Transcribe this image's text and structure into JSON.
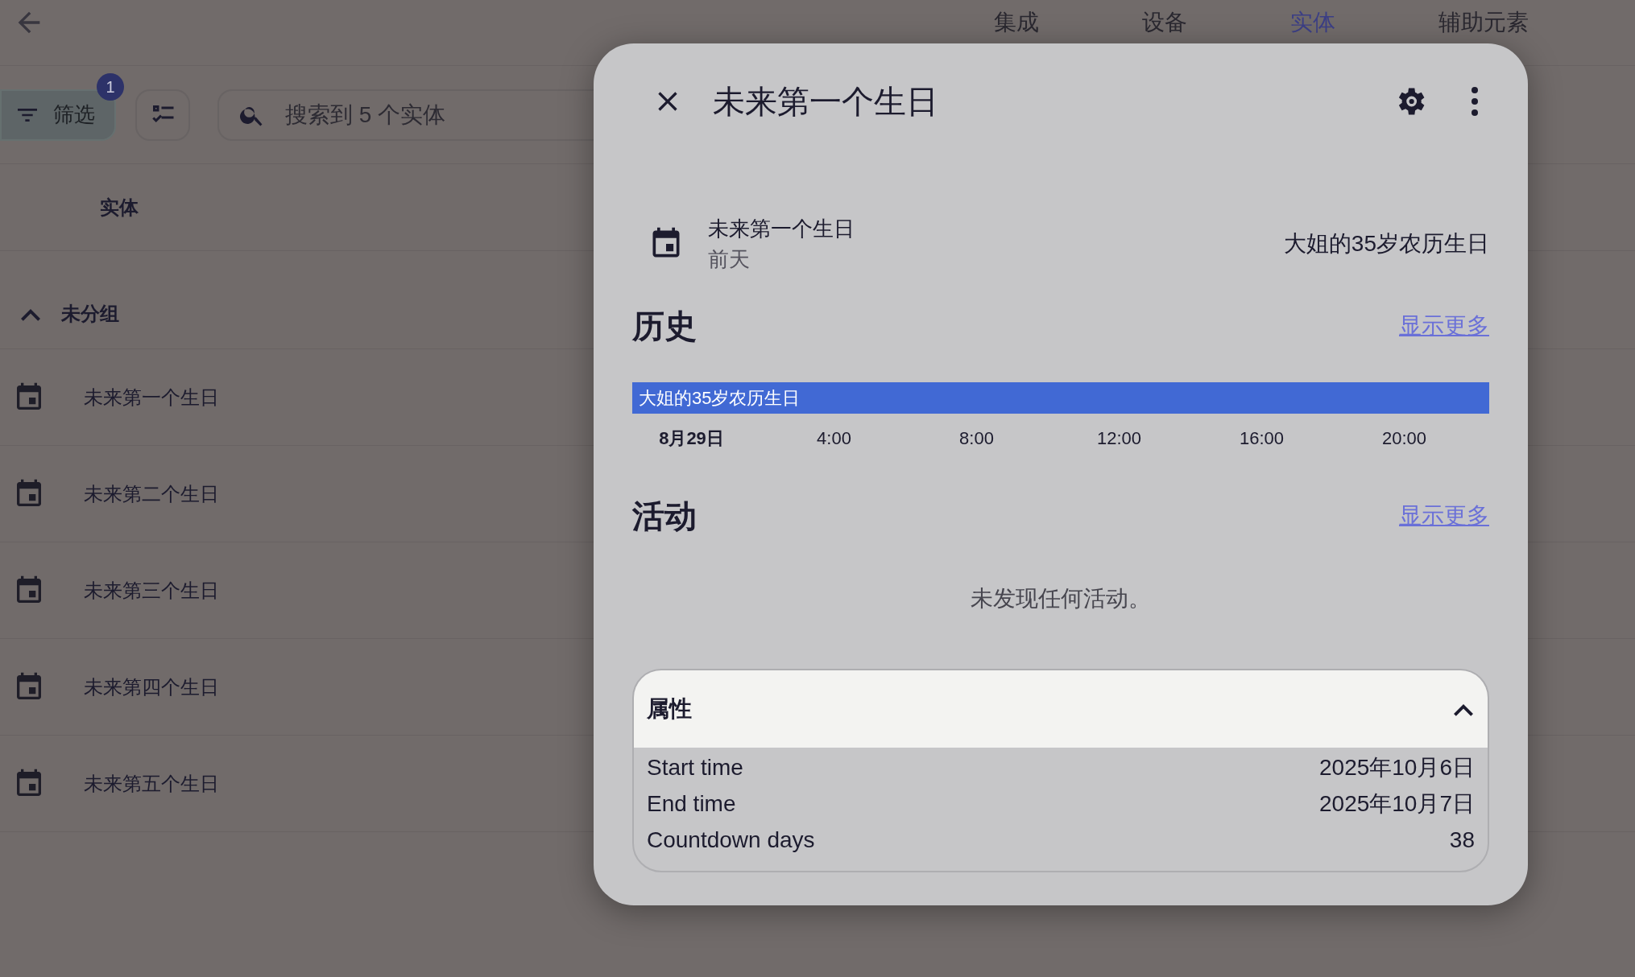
{
  "top_bar": {
    "tabs": [
      {
        "label": "集成",
        "selected": false
      },
      {
        "label": "设备",
        "selected": false
      },
      {
        "label": "实体",
        "selected": true
      },
      {
        "label": "辅助元素",
        "selected": false
      }
    ]
  },
  "toolbar": {
    "filter": {
      "label": "筛选",
      "badge": "1"
    },
    "search": {
      "placeholder": "搜索到 5 个实体"
    }
  },
  "table": {
    "column": "实体",
    "group": {
      "label": "未分组",
      "expanded": true
    },
    "rows": [
      {
        "name": "未来第一个生日"
      },
      {
        "name": "未来第二个生日"
      },
      {
        "name": "未来第三个生日"
      },
      {
        "name": "未来第四个生日"
      },
      {
        "name": "未来第五个生日"
      }
    ]
  },
  "dialog": {
    "title": "未来第一个生日",
    "entity": {
      "name": "未来第一个生日",
      "relative_time": "前天",
      "state": "大姐的35岁农历生日"
    },
    "history": {
      "heading": "历史",
      "more_link": "显示更多",
      "timeline_label": "大姐的35岁农历生日",
      "axis_labels": [
        {
          "label": "8月29日",
          "bold": true
        },
        {
          "label": "4:00",
          "bold": false
        },
        {
          "label": "8:00",
          "bold": false
        },
        {
          "label": "12:00",
          "bold": false
        },
        {
          "label": "16:00",
          "bold": false
        },
        {
          "label": "20:00",
          "bold": false
        }
      ]
    },
    "activity": {
      "heading": "活动",
      "more_link": "显示更多",
      "empty_text": "未发现任何活动。"
    },
    "attributes": {
      "heading": "属性",
      "expanded": true,
      "rows": [
        {
          "name": "Start time",
          "value": "2025年10月6日"
        },
        {
          "name": "End time",
          "value": "2025年10月7日"
        },
        {
          "name": "Countdown days",
          "value": "38"
        }
      ]
    }
  }
}
